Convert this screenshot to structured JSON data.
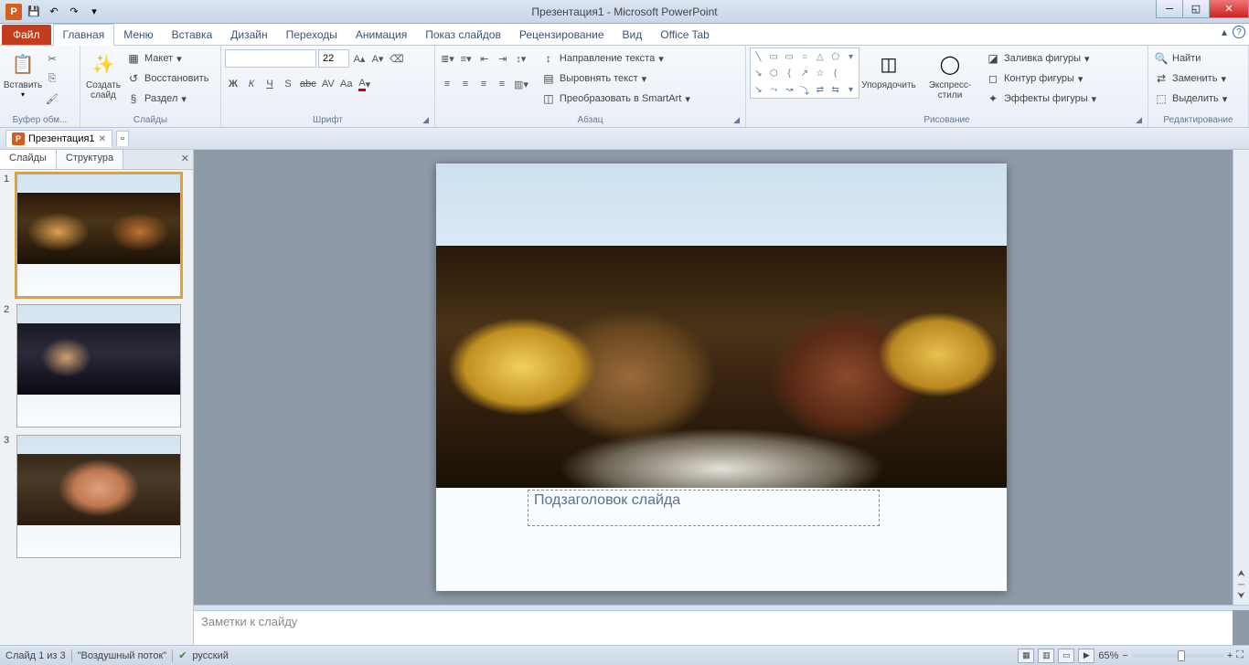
{
  "title": "Презентация1 - Microsoft PowerPoint",
  "qat": {
    "save": "💾",
    "undo": "↶",
    "redo": "↷",
    "down": "▾"
  },
  "tabs": {
    "file": "Файл",
    "items": [
      "Главная",
      "Меню",
      "Вставка",
      "Дизайн",
      "Переходы",
      "Анимация",
      "Показ слайдов",
      "Рецензирование",
      "Вид",
      "Office Tab"
    ],
    "active": 0,
    "min": "▴",
    "help": "?"
  },
  "ribbon": {
    "clipboard": {
      "paste": "Вставить",
      "cut": "✂",
      "copy": "⎘",
      "fmt": "🖌",
      "label": "Буфер обм..."
    },
    "slides": {
      "new": "Создать\nслайд",
      "layout": "Макет",
      "reset": "Восстановить",
      "section": "Раздел",
      "label": "Слайды"
    },
    "font": {
      "name": "",
      "size": "22",
      "grow": "A▴",
      "shrink": "A▾",
      "b": "Ж",
      "i": "К",
      "u": "Ч",
      "s": "S",
      "strike": "abc",
      "spacing": "AV",
      "case": "Aa",
      "color": "A",
      "clear": "⌫",
      "label": "Шрифт"
    },
    "para": {
      "label": "Абзац",
      "dir": "Направление текста",
      "align": "Выровнять текст",
      "smart": "Преобразовать в SmartArt"
    },
    "draw": {
      "arrange": "Упорядочить",
      "styles": "Экспресс-стили",
      "fill": "Заливка фигуры",
      "outline": "Контур фигуры",
      "effects": "Эффекты фигуры",
      "label": "Рисование"
    },
    "edit": {
      "find": "Найти",
      "replace": "Заменить",
      "select": "Выделить",
      "label": "Редактирование"
    }
  },
  "doc_tabs": {
    "name": "Презентация1",
    "close": "✕"
  },
  "thumb": {
    "tabs": [
      "Слайды",
      "Структура"
    ],
    "close": "✕",
    "items": [
      "1",
      "2",
      "3"
    ]
  },
  "slide": {
    "subtitle": "Подзаголовок слайда"
  },
  "notes": {
    "placeholder": "Заметки к слайду"
  },
  "status": {
    "slide_of": "Слайд 1 из 3",
    "theme": "\"Воздушный поток\"",
    "lang_icon": "✔",
    "lang": "русский",
    "zoom": "65%",
    "minus": "−",
    "plus": "+",
    "fit": "⛶"
  }
}
